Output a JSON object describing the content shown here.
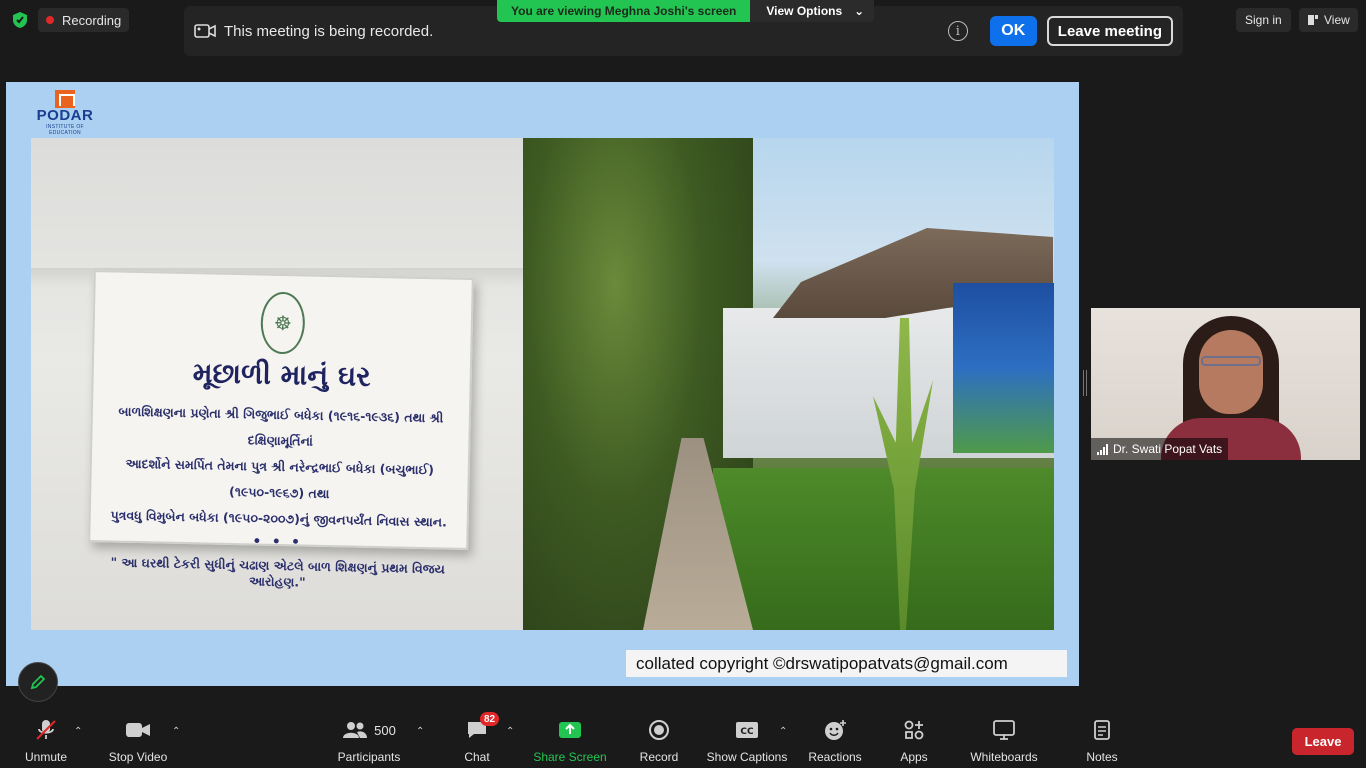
{
  "top": {
    "recording_label": "Recording",
    "sign_in": "Sign in",
    "view": "View"
  },
  "banner": {
    "message": "This meeting is being recorded.",
    "ok": "OK",
    "leave_meeting": "Leave meeting"
  },
  "viewing": {
    "text": "You are viewing Meghna Joshi's screen",
    "options": "View Options"
  },
  "slide": {
    "logo_name": "PODAR",
    "logo_sub": "INSTITUTE OF EDUCATION",
    "plaque_title": "મૂછાળી માનું ઘર",
    "plaque_line1": "બાળશિક્ષણના પ્રણેતા શ્રી ગિજુભાઈ બધેકા (૧૯૧૬-૧૯૩૬) તથા શ્રી દક્ષિણામૂર્તિનાં",
    "plaque_line2": "આદર્શોને સમર્પિત તેમના પુત્ર શ્રી નરેન્દ્રભાઈ બધેકા (બચુભાઈ) (૧૯૫૦-૧૯૬૭) તથા",
    "plaque_line3": "પુત્રવધુ વિમુબેન બધેકા (૧૯૫૦-૨૦૦૭)નું જીવનપર્યંત નિવાસ સ્થાન.",
    "plaque_dots": "• • •",
    "plaque_quote": "\" આ ઘરથી ટેકરી સુધીનું ચઢાણ એટલે બાળ શિક્ષણનું પ્રથમ વિજય આરોહણ.\"",
    "copyright": "collated copyright ©drswatipopatvats@gmail.com"
  },
  "participant": {
    "name": "Dr. Swati Popat Vats"
  },
  "toolbar": {
    "unmute": "Unmute",
    "stop_video": "Stop Video",
    "participants": "Participants",
    "participants_count": "500",
    "chat": "Chat",
    "chat_badge": "82",
    "share_screen": "Share Screen",
    "record": "Record",
    "show_captions": "Show Captions",
    "reactions": "Reactions",
    "apps": "Apps",
    "whiteboards": "Whiteboards",
    "notes": "Notes",
    "leave": "Leave"
  },
  "colors": {
    "accent_blue": "#0e71eb",
    "green": "#23c552",
    "leave_red": "#c8262c",
    "slide_bg": "#abd0f2"
  }
}
